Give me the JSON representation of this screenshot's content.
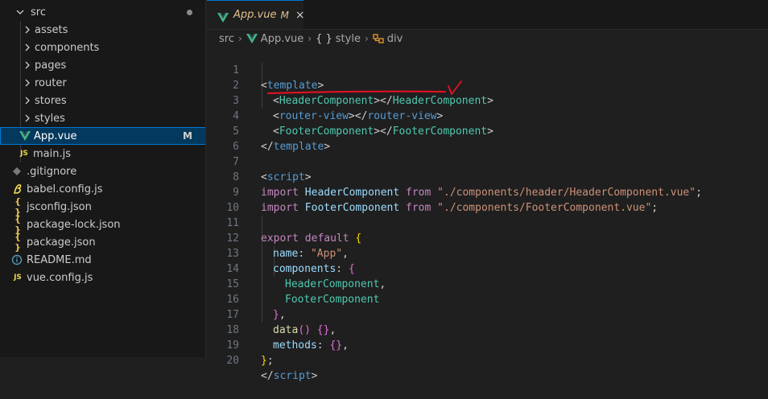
{
  "sidebar": {
    "folder": {
      "label": "src"
    },
    "subfolders": [
      "assets",
      "components",
      "pages",
      "router",
      "stores",
      "styles"
    ],
    "files_in_src": [
      {
        "label": "App.vue",
        "icon": "vue-icon",
        "badge": "M",
        "selected": true
      },
      {
        "label": "main.js",
        "icon": "js-icon"
      }
    ],
    "root_files": [
      {
        "label": ".gitignore",
        "icon": "git-icon"
      },
      {
        "label": "babel.config.js",
        "icon": "babel-icon"
      },
      {
        "label": "jsconfig.json",
        "icon": "json-icon"
      },
      {
        "label": "package-lock.json",
        "icon": "json-icon"
      },
      {
        "label": "package.json",
        "icon": "json-icon"
      },
      {
        "label": "README.md",
        "icon": "info-icon"
      },
      {
        "label": "vue.config.js",
        "icon": "js-icon"
      }
    ],
    "js_glyph": "JS",
    "json_glyph": "{ }"
  },
  "tab": {
    "title": "App.vue",
    "modified": "M",
    "close": "×"
  },
  "breadcrumb": {
    "folder": "src",
    "file": "App.vue",
    "section": "style",
    "section_glyph": "{ }",
    "element": "div",
    "sep": "›"
  },
  "code": {
    "line_numbers": [
      "1",
      "2",
      "3",
      "4",
      "5",
      "6",
      "7",
      "8",
      "9",
      "10",
      "11",
      "12",
      "13",
      "14",
      "15",
      "16",
      "17",
      "18",
      "19",
      "20"
    ],
    "l1_open": "<",
    "l1_tag": "template",
    "l1_close": ">",
    "l2_a": "<",
    "l2_tag": "HeaderComponent",
    "l2_b": "></",
    "l2_tag2": "HeaderComponent",
    "l2_c": ">",
    "l3_a": "<",
    "l3_tag": "router-view",
    "l3_b": "></",
    "l3_tag2": "router-view",
    "l3_c": ">",
    "l4_a": "<",
    "l4_tag": "FooterComponent",
    "l4_b": "></",
    "l4_tag2": "FooterComponent",
    "l4_c": ">",
    "l6_a": "</",
    "l6_tag": "template",
    "l6_c": ">",
    "l7_a": "<",
    "l7_tag": "script",
    "l7_c": ">",
    "l8_kw": "import",
    "l8_var": "HeaderComponent",
    "l8_from": "from",
    "l8_str": "\"./components/header/HeaderComponent.vue\"",
    "l8_end": ";",
    "l9_kw": "import",
    "l9_var": "FooterComponent",
    "l9_from": "from",
    "l9_str": "\"./components/FooterComponent.vue\"",
    "l9_end": ";",
    "l11_kw": "export",
    "l11_kw2": "default",
    "l11_br": "{",
    "l12_prop": "name",
    "l12_colon": ": ",
    "l12_str": "\"App\"",
    "l12_end": ",",
    "l13_prop": "components",
    "l13_colon": ": ",
    "l13_br": "{",
    "l14_v": "HeaderComponent",
    "l14_end": ",",
    "l15_v": "FooterComponent",
    "l16_br": "}",
    "l16_end": ",",
    "l17_fn": "data",
    "l17_paren": "()",
    "l17_br": "{}",
    "l17_end": ",",
    "l18_prop": "methods",
    "l18_colon": ": ",
    "l18_br": "{}",
    "l18_end": ",",
    "l19_br": "}",
    "l19_end": ";",
    "l20_a": "</",
    "l20_tag": "script",
    "l20_c": ">"
  },
  "colors": {
    "annotation": "#e81123",
    "selection": "#04395e",
    "accent": "#0078d4"
  }
}
